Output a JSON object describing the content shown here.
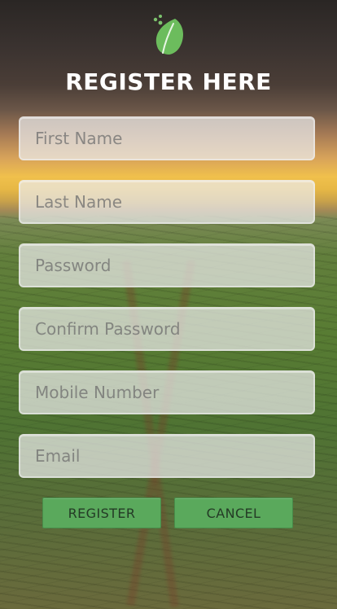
{
  "header": {
    "title": "REGISTER HERE",
    "logo_icon": "leaf-logo-icon"
  },
  "form": {
    "fields": [
      {
        "placeholder": "First Name",
        "value": ""
      },
      {
        "placeholder": "Last Name",
        "value": ""
      },
      {
        "placeholder": "Password",
        "value": ""
      },
      {
        "placeholder": "Confirm Password",
        "value": ""
      },
      {
        "placeholder": "Mobile Number",
        "value": ""
      },
      {
        "placeholder": "Email",
        "value": ""
      }
    ]
  },
  "actions": {
    "register_label": "REGISTER",
    "cancel_label": "CANCEL"
  },
  "colors": {
    "button_green": "#5aa95c",
    "title_white": "#ffffff",
    "field_bg": "#ebebeb"
  }
}
